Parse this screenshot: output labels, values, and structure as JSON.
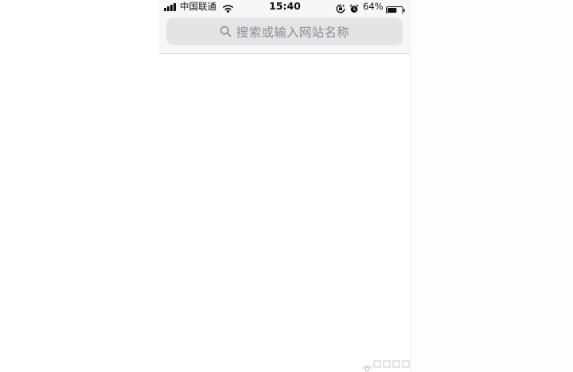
{
  "status_bar": {
    "carrier": "中国联通",
    "time": "15:40",
    "battery_percent": "64%",
    "battery_level": 0.64,
    "icons": [
      "signal-icon",
      "wifi-icon",
      "rotation-lock-icon",
      "alarm-icon",
      "battery-icon"
    ]
  },
  "search": {
    "placeholder": "搜索或输入网站名称",
    "icon": "search-icon"
  },
  "colors": {
    "bar_bg": "#f7f7f7",
    "search_bg": "#e4e4e5",
    "placeholder": "#8e8e93"
  }
}
